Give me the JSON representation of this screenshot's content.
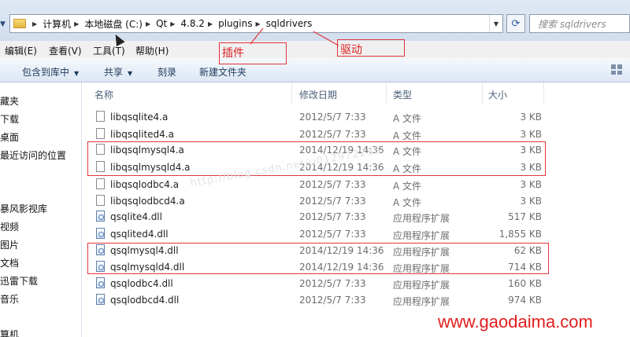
{
  "address": {
    "crumbs": [
      "计算机",
      "本地磁盘 (C:)",
      "Qt",
      "4.8.2",
      "plugins",
      "sqldrivers"
    ],
    "search_placeholder": "搜索 sqldrivers"
  },
  "menu": [
    "编辑(E)",
    "查看(V)",
    "工具(T)",
    "帮助(H)"
  ],
  "toolbar": {
    "include_library": "包含到库中",
    "share": "共享",
    "burn": "刻录",
    "new_folder": "新建文件夹"
  },
  "nav": [
    "藏夹",
    "下载",
    "桌面",
    "最近访问的位置",
    "暴风影视库",
    "视频",
    "图片",
    "文档",
    "迅雷下载",
    "音乐",
    "算机"
  ],
  "columns": {
    "name": "名称",
    "date": "修改日期",
    "type": "类型",
    "size": "大小"
  },
  "files": [
    {
      "name": "libqsqlite4.a",
      "date": "2012/5/7 7:33",
      "type": "A 文件",
      "size": "3 KB",
      "icon": "file-icon"
    },
    {
      "name": "libqsqlited4.a",
      "date": "2012/5/7 7:33",
      "type": "A 文件",
      "size": "3 KB",
      "icon": "file-icon"
    },
    {
      "name": "libqsqlmysql4.a",
      "date": "2014/12/19 14:36",
      "type": "A 文件",
      "size": "3 KB",
      "icon": "file-icon"
    },
    {
      "name": "libqsqlmysqld4.a",
      "date": "2014/12/19 14:36",
      "type": "A 文件",
      "size": "3 KB",
      "icon": "file-icon"
    },
    {
      "name": "libqsqlodbc4.a",
      "date": "2012/5/7 7:33",
      "type": "A 文件",
      "size": "3 KB",
      "icon": "file-icon"
    },
    {
      "name": "libqsqlodbcd4.a",
      "date": "2012/5/7 7:33",
      "type": "A 文件",
      "size": "3 KB",
      "icon": "file-icon"
    },
    {
      "name": "qsqlite4.dll",
      "date": "2012/5/7 7:33",
      "type": "应用程序扩展",
      "size": "517 KB",
      "icon": "dll-icon"
    },
    {
      "name": "qsqlited4.dll",
      "date": "2012/5/7 7:33",
      "type": "应用程序扩展",
      "size": "1,855 KB",
      "icon": "dll-icon"
    },
    {
      "name": "qsqlmysql4.dll",
      "date": "2014/12/19 14:36",
      "type": "应用程序扩展",
      "size": "62 KB",
      "icon": "dll-icon"
    },
    {
      "name": "qsqlmysqld4.dll",
      "date": "2014/12/19 14:36",
      "type": "应用程序扩展",
      "size": "714 KB",
      "icon": "dll-icon"
    },
    {
      "name": "qsqlodbc4.dll",
      "date": "2012/5/7 7:33",
      "type": "应用程序扩展",
      "size": "160 KB",
      "icon": "dll-icon"
    },
    {
      "name": "qsqlodbcd4.dll",
      "date": "2012/5/7 7:33",
      "type": "应用程序扩展",
      "size": "974 KB",
      "icon": "dll-icon"
    }
  ],
  "annotations": {
    "plugins_note": "插件",
    "drivers_note": "驱动"
  },
  "watermark": "http://blog.csdn.net/u012972236",
  "brand": "www.gaodaima.com",
  "colors": {
    "accent_red": "#e2353a",
    "brand_red": "#e21d1d"
  }
}
